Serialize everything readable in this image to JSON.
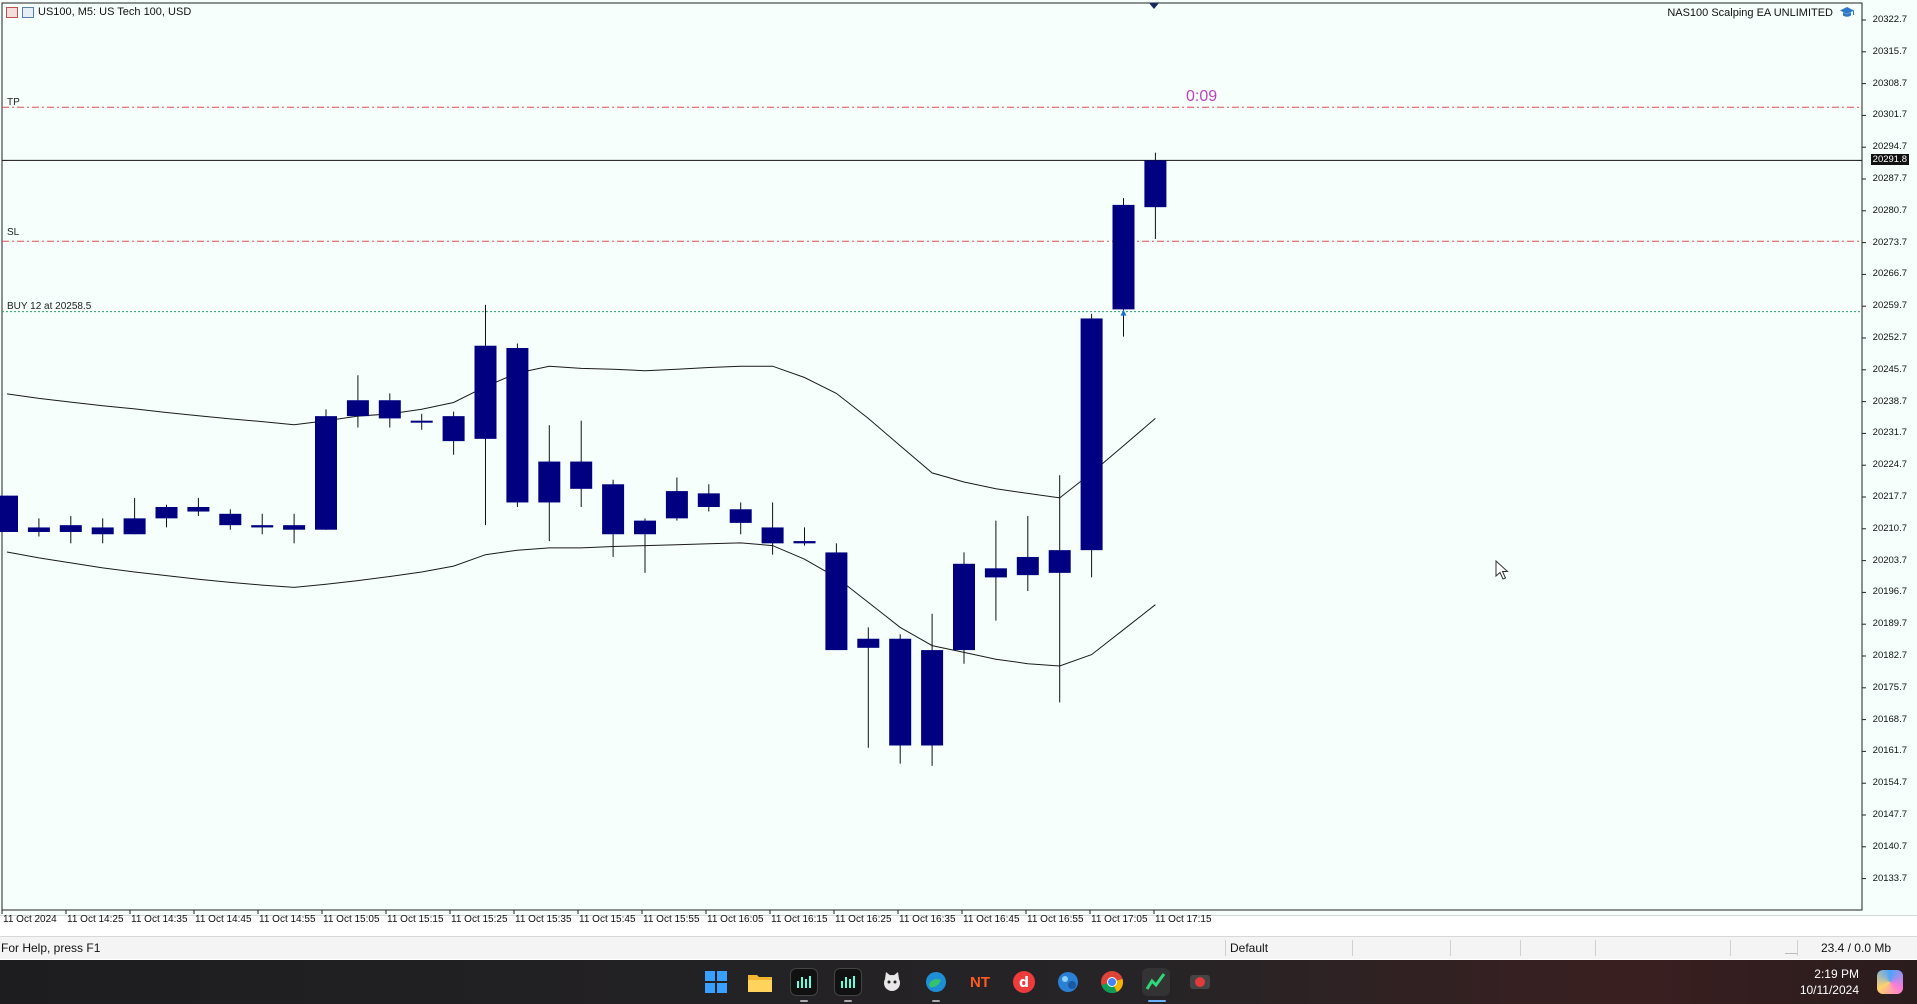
{
  "chart_window": {
    "symbol_title": "US100, M5:  US Tech 100, USD",
    "ea_name": "NAS100 Scalping EA UNLIMITED",
    "timer": "0:09",
    "lines": {
      "tp": {
        "label": "TP",
        "price": 20303.5,
        "color": "#e05050"
      },
      "sl": {
        "label": "SL",
        "price": 20274.0,
        "color": "#e05050"
      },
      "buy": {
        "label": "BUY 12 at 20258.5",
        "price": 20258.5,
        "color": "#2e9e6b"
      },
      "current": {
        "label": "20291.8",
        "price": 20291.8,
        "color": "#111111"
      }
    },
    "price_axis": [
      "20322.7",
      "20315.7",
      "20308.7",
      "20301.7",
      "20294.7",
      "20287.7",
      "20280.7",
      "20273.7",
      "20266.7",
      "20259.7",
      "20252.7",
      "20245.7",
      "20238.7",
      "20231.7",
      "20224.7",
      "20217.7",
      "20210.7",
      "20203.7",
      "20196.7",
      "20189.7",
      "20182.7",
      "20175.7",
      "20168.7",
      "20161.7",
      "20154.7",
      "20147.7",
      "20140.7",
      "20133.7"
    ],
    "time_axis": [
      "11 Oct 2024",
      "11 Oct 14:25",
      "11 Oct 14:35",
      "11 Oct 14:45",
      "11 Oct 14:55",
      "11 Oct 15:05",
      "11 Oct 15:15",
      "11 Oct 15:25",
      "11 Oct 15:35",
      "11 Oct 15:45",
      "11 Oct 15:55",
      "11 Oct 16:05",
      "11 Oct 16:15",
      "11 Oct 16:25",
      "11 Oct 16:35",
      "11 Oct 16:45",
      "11 Oct 16:55",
      "11 Oct 17:05",
      "11 Oct 17:15"
    ],
    "colors": {
      "background": "#f6fffb",
      "candle": "#000080",
      "bands": "#1a1a1a"
    }
  },
  "chart_data": {
    "type": "candlestick",
    "symbol": "US100",
    "timeframe": "M5",
    "y_range": [
      20130,
      20326
    ],
    "candles": [
      {
        "o": 20218.0,
        "h": 20218.0,
        "l": 20210.0,
        "c": 20210.0
      },
      {
        "o": 20210.0,
        "h": 20213.0,
        "l": 20209.0,
        "c": 20211.0
      },
      {
        "o": 20210.0,
        "h": 20213.5,
        "l": 20207.5,
        "c": 20211.5
      },
      {
        "o": 20209.5,
        "h": 20213.0,
        "l": 20207.5,
        "c": 20211.0
      },
      {
        "o": 20209.5,
        "h": 20217.5,
        "l": 20209.5,
        "c": 20213.0
      },
      {
        "o": 20213.0,
        "h": 20216.0,
        "l": 20211.0,
        "c": 20215.5
      },
      {
        "o": 20214.5,
        "h": 20217.5,
        "l": 20213.5,
        "c": 20215.5
      },
      {
        "o": 20211.5,
        "h": 20215.0,
        "l": 20210.5,
        "c": 20214.0
      },
      {
        "o": 20211.0,
        "h": 20214.0,
        "l": 20209.5,
        "c": 20211.5
      },
      {
        "o": 20210.5,
        "h": 20214.0,
        "l": 20207.5,
        "c": 20211.5
      },
      {
        "o": 20210.5,
        "h": 20237.0,
        "l": 20210.5,
        "c": 20235.5
      },
      {
        "o": 20235.5,
        "h": 20244.5,
        "l": 20233.0,
        "c": 20239.0
      },
      {
        "o": 20235.0,
        "h": 20240.5,
        "l": 20233.0,
        "c": 20239.0
      },
      {
        "o": 20234.5,
        "h": 20236.0,
        "l": 20232.5,
        "c": 20234.5
      },
      {
        "o": 20235.5,
        "h": 20236.5,
        "l": 20227.0,
        "c": 20230.0
      },
      {
        "o": 20230.5,
        "h": 20260.0,
        "l": 20211.5,
        "c": 20251.0
      },
      {
        "o": 20250.5,
        "h": 20251.5,
        "l": 20215.5,
        "c": 20216.5
      },
      {
        "o": 20216.5,
        "h": 20233.5,
        "l": 20208.0,
        "c": 20225.5
      },
      {
        "o": 20219.5,
        "h": 20234.5,
        "l": 20215.5,
        "c": 20225.5
      },
      {
        "o": 20220.5,
        "h": 20221.5,
        "l": 20204.5,
        "c": 20209.5
      },
      {
        "o": 20209.5,
        "h": 20213.0,
        "l": 20201.0,
        "c": 20212.5
      },
      {
        "o": 20213.0,
        "h": 20222.0,
        "l": 20212.5,
        "c": 20219.0
      },
      {
        "o": 20218.5,
        "h": 20220.5,
        "l": 20214.5,
        "c": 20215.5
      },
      {
        "o": 20215.0,
        "h": 20216.5,
        "l": 20209.5,
        "c": 20212.0
      },
      {
        "o": 20211.0,
        "h": 20216.5,
        "l": 20205.0,
        "c": 20207.5
      },
      {
        "o": 20207.5,
        "h": 20211.0,
        "l": 20207.0,
        "c": 20208.0
      },
      {
        "o": 20205.5,
        "h": 20207.5,
        "l": 20185.5,
        "c": 20184.0
      },
      {
        "o": 20186.5,
        "h": 20189.0,
        "l": 20162.5,
        "c": 20184.5
      },
      {
        "o": 20186.5,
        "h": 20187.5,
        "l": 20159.0,
        "c": 20163.0
      },
      {
        "o": 20184.0,
        "h": 20192.0,
        "l": 20158.5,
        "c": 20163.0
      },
      {
        "o": 20184.0,
        "h": 20205.5,
        "l": 20181.0,
        "c": 20203.0
      },
      {
        "o": 20202.0,
        "h": 20212.5,
        "l": 20190.5,
        "c": 20200.0
      },
      {
        "o": 20200.5,
        "h": 20213.5,
        "l": 20197.0,
        "c": 20204.5
      },
      {
        "o": 20201.0,
        "h": 20222.5,
        "l": 20172.5,
        "c": 20206.0
      },
      {
        "o": 20206.0,
        "h": 20258.0,
        "l": 20200.0,
        "c": 20257.0
      },
      {
        "o": 20259.0,
        "h": 20283.5,
        "l": 20253.0,
        "c": 20282.0
      },
      {
        "o": 20281.5,
        "h": 20293.5,
        "l": 20274.5,
        "c": 20291.8
      }
    ],
    "bands": {
      "upper": [
        20240.4,
        20239.4,
        20238.6,
        20237.8,
        20237.1,
        20236.3,
        20235.6,
        20234.9,
        20234.3,
        20233.6,
        20234.5,
        20235.5,
        20236.0,
        20237.0,
        20238.5,
        20242.0,
        20245.0,
        20246.5,
        20246.0,
        20245.8,
        20245.5,
        20245.8,
        20246.2,
        20246.5,
        20246.5,
        20244.0,
        20240.5,
        20235.0,
        20229.0,
        20223.0,
        20221.0,
        20219.5,
        20218.5,
        20217.5,
        20223.0,
        20229.0,
        20235.0
      ],
      "middle": [
        20205.6,
        20204.3,
        20203.2,
        20202.1,
        20201.2,
        20200.4,
        20199.6,
        20198.9,
        20198.3,
        20197.8,
        20198.5,
        20199.3,
        20200.2,
        20201.2,
        20202.5,
        20205.0,
        20206.0,
        20206.5,
        20206.5,
        20206.8,
        20207.0,
        20207.2,
        20207.4,
        20207.6,
        20207.0,
        20204.0,
        20200.0,
        20194.5,
        20189.0,
        20185.0,
        20183.5,
        20182.0,
        20181.0,
        20180.5,
        20183.0,
        20188.5,
        20194.0
      ]
    }
  },
  "status_bar": {
    "help_text": "For Help, press F1",
    "profile": "Default",
    "traffic": "23.4 / 0.0 Mb"
  },
  "taskbar": {
    "icons": [
      "windows-start-icon",
      "file-explorer-icon",
      "mt5-icon",
      "mt5-icon",
      "cat-app-icon",
      "edge-icon",
      "nt-app-icon",
      "red-app-icon",
      "sphere-app-icon",
      "chrome-icon",
      "trading-app-icon",
      "record-app-icon"
    ],
    "time": "2:19 PM",
    "date": "10/11/2024"
  }
}
